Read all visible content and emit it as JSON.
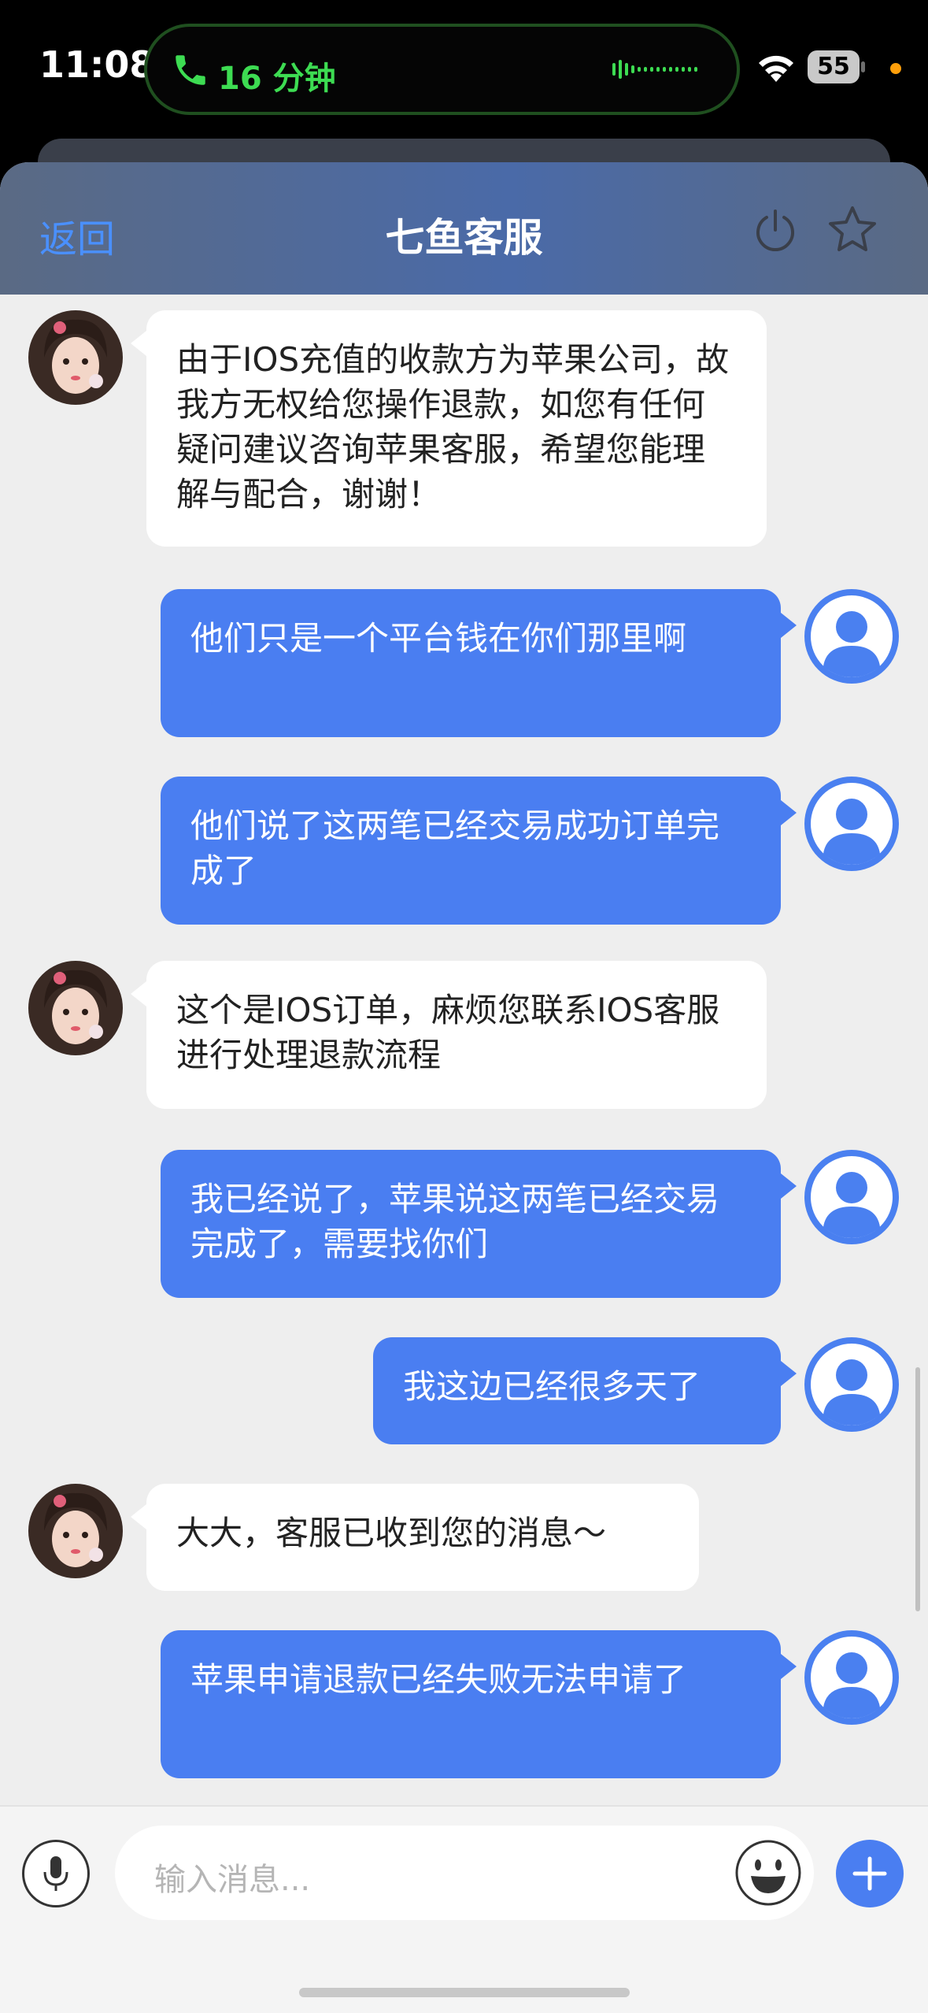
{
  "status_bar": {
    "time": "11:08",
    "call_duration": "16 分钟",
    "battery": "55",
    "colors": {
      "call_green": "#3ddc52",
      "privacy_dot": "#ff9f0a"
    }
  },
  "nav": {
    "back_label": "返回",
    "title": "七鱼客服",
    "icons": [
      "power-icon",
      "star-icon"
    ]
  },
  "messages": [
    {
      "sender": "agent",
      "text": "由于IOS充值的收款方为苹果公司，故我方无权给您操作退款，如您有任何疑问建议咨询苹果客服，希望您能理解与配合，谢谢！"
    },
    {
      "sender": "user",
      "text": "他们只是一个平台钱在你们那里啊"
    },
    {
      "sender": "user",
      "text": "他们说了这两笔已经交易成功订单完成了"
    },
    {
      "sender": "agent",
      "text": "这个是IOS订单，麻烦您联系IOS客服进行处理退款流程"
    },
    {
      "sender": "user",
      "text": "我已经说了，苹果说这两笔已经交易完成了，需要找你们"
    },
    {
      "sender": "user",
      "text": "我这边已经很多天了"
    },
    {
      "sender": "agent",
      "text": "大大，客服已收到您的消息～"
    },
    {
      "sender": "user",
      "text": "苹果申请退款已经失败无法申请了"
    }
  ],
  "input": {
    "placeholder": "输入消息...",
    "icons": [
      "microphone-icon",
      "emoji-icon",
      "plus-icon"
    ]
  },
  "colors": {
    "accent": "#4a7ef1",
    "link": "#4a90ff",
    "chat_background": "#eeeeee"
  }
}
